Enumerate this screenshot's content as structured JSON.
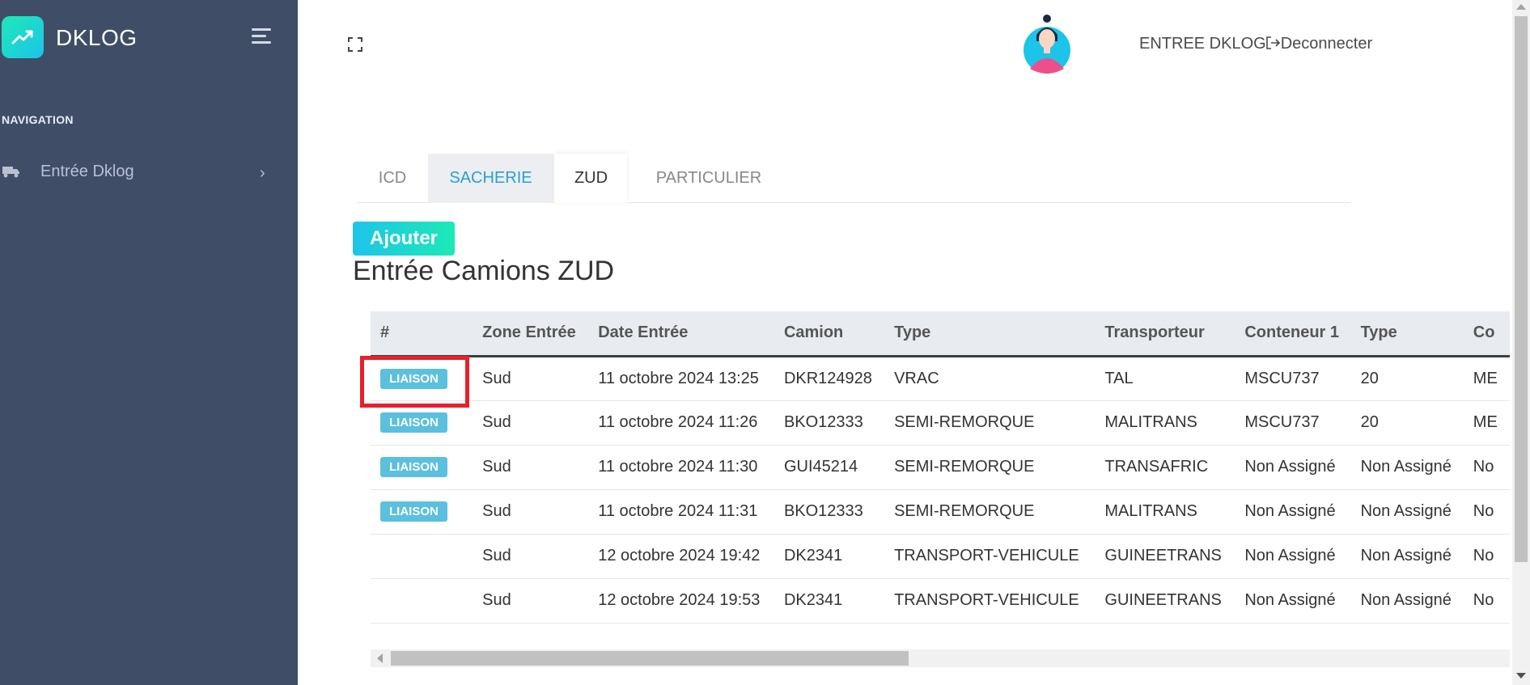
{
  "sidebar": {
    "brand": "DKLOG",
    "nav_caption": "NAVIGATION",
    "items": [
      {
        "label": "Entrée Dklog",
        "icon": "truck-icon"
      }
    ]
  },
  "header": {
    "user_label": "ENTREE DKLOG",
    "logout_label": "Deconnecter"
  },
  "tabs": [
    {
      "label": "ICD"
    },
    {
      "label": "SACHERIE"
    },
    {
      "label": "ZUD",
      "active": true
    },
    {
      "label": "PARTICULIER"
    }
  ],
  "main": {
    "add_button": "Ajouter",
    "title": "Entrée Camions ZUD"
  },
  "table": {
    "columns": [
      "#",
      "Zone Entrée",
      "Date Entrée",
      "Camion",
      "Type",
      "Transporteur",
      "Conteneur 1",
      "Type",
      "Co"
    ],
    "rows": [
      {
        "badge": "LIAISON",
        "zone": "Sud",
        "date": "11 octobre 2024 13:25",
        "camion": "DKR124928",
        "type": "VRAC",
        "transporteur": "TAL",
        "conteneur": "MSCU737",
        "type2": "20",
        "extra": "ME"
      },
      {
        "badge": "LIAISON",
        "zone": "Sud",
        "date": "11 octobre 2024 11:26",
        "camion": "BKO12333",
        "type": "SEMI-REMORQUE",
        "transporteur": "MALITRANS",
        "conteneur": "MSCU737",
        "type2": "20",
        "extra": "ME"
      },
      {
        "badge": "LIAISON",
        "zone": "Sud",
        "date": "11 octobre 2024 11:30",
        "camion": "GUI45214",
        "type": "SEMI-REMORQUE",
        "transporteur": "TRANSAFRIC",
        "conteneur": "Non Assigné",
        "type2": "Non Assigné",
        "extra": "No"
      },
      {
        "badge": "LIAISON",
        "zone": "Sud",
        "date": "11 octobre 2024 11:31",
        "camion": "BKO12333",
        "type": "SEMI-REMORQUE",
        "transporteur": "MALITRANS",
        "conteneur": "Non Assigné",
        "type2": "Non Assigné",
        "extra": "No"
      },
      {
        "badge": "",
        "zone": "Sud",
        "date": "12 octobre 2024 19:42",
        "camion": "DK2341",
        "type": "TRANSPORT-VEHICULE",
        "transporteur": "GUINEETRANS",
        "conteneur": "Non Assigné",
        "type2": "Non Assigné",
        "extra": "No"
      },
      {
        "badge": "",
        "zone": "Sud",
        "date": "12 octobre 2024 19:53",
        "camion": "DK2341",
        "type": "TRANSPORT-VEHICULE",
        "transporteur": "GUINEETRANS",
        "conteneur": "Non Assigné",
        "type2": "Non Assigné",
        "extra": "No"
      }
    ]
  },
  "colors": {
    "sidebar_bg": "#3f4d67",
    "accent_start": "#1dc4e9",
    "accent_end": "#1de9b6",
    "badge": "#5bc0de",
    "highlight": "#e5212b",
    "tab_active_text": "#2a9fd6"
  }
}
